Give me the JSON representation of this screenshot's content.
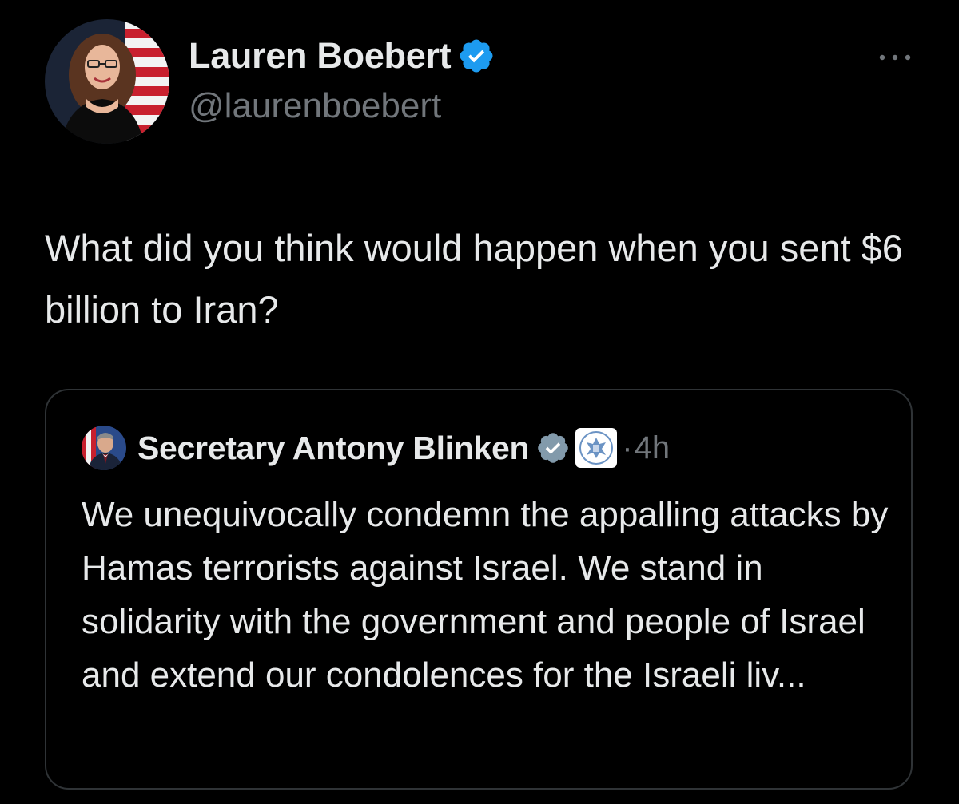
{
  "tweet": {
    "author_name": "Lauren Boebert",
    "author_handle": "@laurenboebert",
    "text": "What did you think would happen when you sent $6 billion to Iran?",
    "more_icon": "more-horizontal-icon"
  },
  "quoted_tweet": {
    "author_name": "Secretary Antony Blinken",
    "separator": "·",
    "time": "4h",
    "text": "We unequivocally condemn the appalling attacks by Hamas terrorists against Israel. We stand in solidarity with the government and people of Israel and extend our condolences for the Israeli liv..."
  },
  "colors": {
    "background": "#000000",
    "primary_text": "#e7e9ea",
    "secondary_text": "#71767b",
    "verified_blue": "#1d9bf0",
    "verified_gray": "#829aab",
    "card_border": "#2f3336"
  }
}
